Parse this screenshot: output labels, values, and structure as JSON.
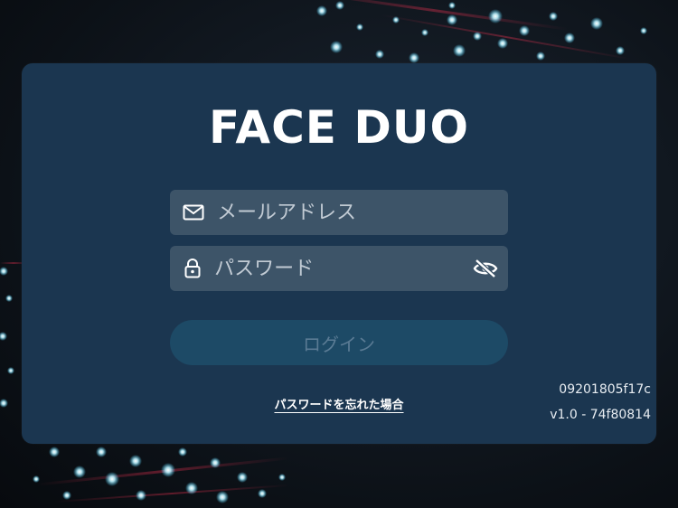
{
  "app": {
    "logo_text": "FACE DUO"
  },
  "form": {
    "email_placeholder": "メールアドレス",
    "email_value": "",
    "password_placeholder": "パスワード",
    "password_value": "",
    "login_label": "ログイン",
    "forgot_label": "パスワードを忘れた場合"
  },
  "device": {
    "id": "09201805f17c",
    "version": "v1.0 - 74f80814"
  },
  "icons": {
    "email": "mail-icon",
    "password": "lock-icon",
    "visibility": "eye-slash-icon"
  },
  "colors": {
    "card": "#1b3650",
    "field": "#3d5468",
    "button": "#1d4a66",
    "button_text": "#5a7b94"
  }
}
